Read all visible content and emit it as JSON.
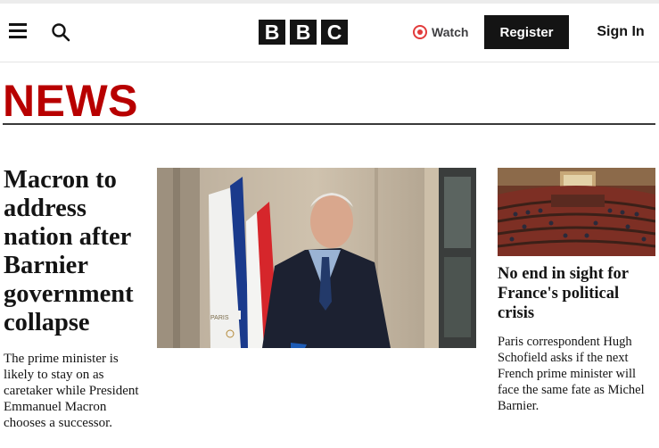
{
  "header": {
    "menu_icon": "hamburger-menu-icon",
    "search_icon": "search-icon",
    "logo_letters": [
      "B",
      "B",
      "C"
    ],
    "watch_label": "Watch",
    "watch_icon": "live-dot-icon",
    "register_label": "Register",
    "signin_label": "Sign In",
    "accent_color": "#e23b3b"
  },
  "section": {
    "title": "NEWS",
    "color": "#b80000"
  },
  "lead_story": {
    "headline": "Macron to address nation after Barnier government collapse",
    "summary": "The prime minister is likely to stay on as caretaker while President Emmanuel Macron chooses a successor.",
    "image_flag_text": "PARIS"
  },
  "side_story": {
    "headline": "No end in sight for France's political crisis",
    "summary": "Paris correspondent Hugh Schofield asks if the next French prime minister will face the same fate as Michel Barnier."
  }
}
